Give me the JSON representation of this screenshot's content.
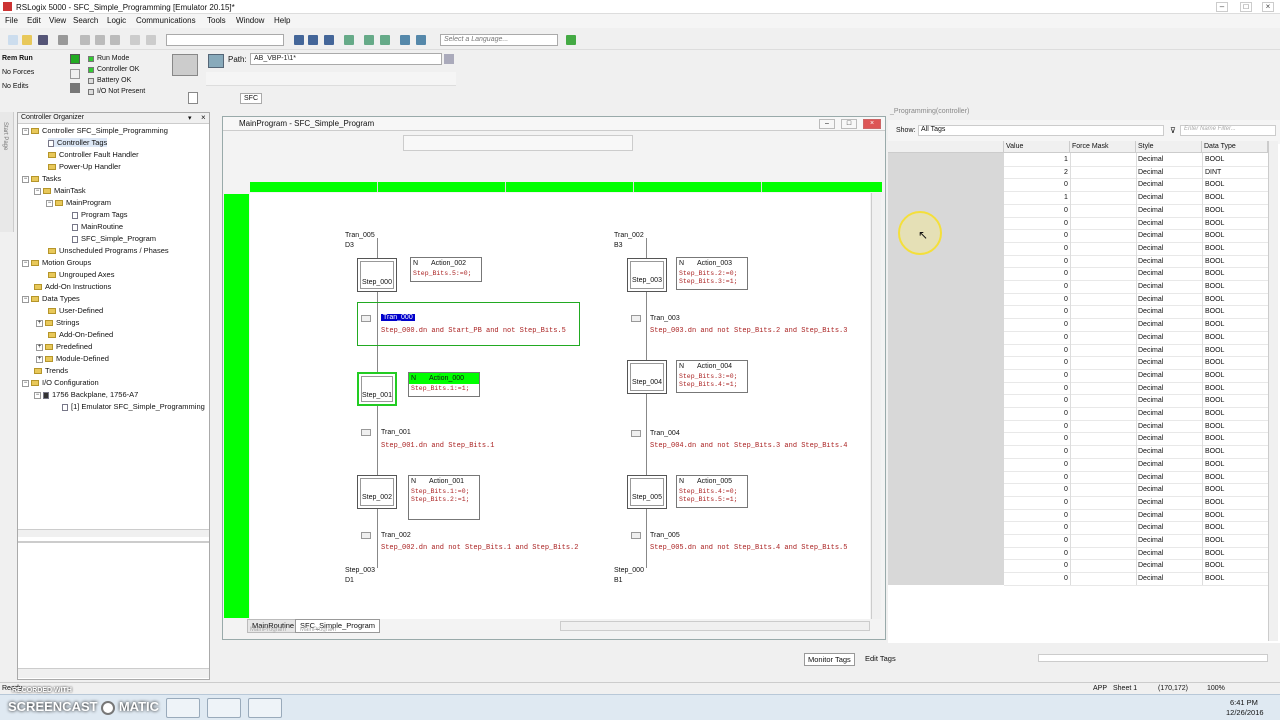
{
  "app": {
    "title": "RSLogix 5000 - SFC_Simple_Programming [Emulator 20.15]*",
    "menu": [
      "File",
      "Edit",
      "View",
      "Search",
      "Logic",
      "Communications",
      "Tools",
      "Window",
      "Help"
    ],
    "language_placeholder": "Select a Language..."
  },
  "status": {
    "mode": "Rem Run",
    "forces": "No Forces",
    "edits": "No Edits",
    "run_mode": "Run Mode",
    "controller_ok": "Controller OK",
    "battery_ok": "Battery OK",
    "io_not_present": "I/O Not Present"
  },
  "path": {
    "label": "Path:",
    "value": "AB_VBP-1\\1*",
    "sfc_tab": "SFC"
  },
  "organizer": {
    "title": "Controller Organizer",
    "items": [
      "Controller SFC_Simple_Programming",
      "Controller Tags",
      "Controller Fault Handler",
      "Power-Up Handler",
      "Tasks",
      "MainTask",
      "MainProgram",
      "Program Tags",
      "MainRoutine",
      "SFC_Simple_Program",
      "Unscheduled Programs / Phases",
      "Motion Groups",
      "Ungrouped Axes",
      "Add-On Instructions",
      "Data Types",
      "User-Defined",
      "Strings",
      "Add-On-Defined",
      "Predefined",
      "Module-Defined",
      "Trends",
      "I/O Configuration",
      "1756 Backplane, 1756-A7",
      "[1] Emulator SFC_Simple_Programming"
    ],
    "side_label": "Start Page"
  },
  "sfc": {
    "window_title": "MainProgram - SFC_Simple_Program",
    "tabs": [
      "MainRoutine",
      "SFC_Simple_Program"
    ],
    "tab_sub": [
      "MainProgram",
      "MainProgram"
    ],
    "left": {
      "top_tran": "Tran_005",
      "top_ref": "D3",
      "steps": [
        "Step_000",
        "Step_001",
        "Step_002"
      ],
      "actions": [
        {
          "q": "N",
          "name": "Action_002",
          "code": "Step_Bits.5:=0;"
        },
        {
          "q": "N",
          "name": "Action_000",
          "code": "Step_Bits.1:=1;"
        },
        {
          "q": "N",
          "name": "Action_001",
          "code": "Step_Bits.1:=0;\nStep_Bits.2:=1;"
        }
      ],
      "transitions": [
        {
          "name": "Tran_000",
          "cond": "Step_000.dn and Start_PB and not Step_Bits.5"
        },
        {
          "name": "Tran_001",
          "cond": "Step_001.dn and Step_Bits.1"
        },
        {
          "name": "Tran_002",
          "cond": "Step_002.dn and not Step_Bits.1 and Step_Bits.2"
        }
      ],
      "bottom_step": "Step_003",
      "bottom_ref": "D1"
    },
    "right": {
      "top_tran": "Tran_002",
      "top_ref": "B3",
      "steps": [
        "Step_003",
        "Step_004",
        "Step_005"
      ],
      "actions": [
        {
          "q": "N",
          "name": "Action_003",
          "code": "Step_Bits.2:=0;\nStep_Bits.3:=1;"
        },
        {
          "q": "N",
          "name": "Action_004",
          "code": "Step_Bits.3:=0;\nStep_Bits.4:=1;"
        },
        {
          "q": "N",
          "name": "Action_005",
          "code": "Step_Bits.4:=0;\nStep_Bits.5:=1;"
        }
      ],
      "transitions": [
        {
          "name": "Tran_003",
          "cond": "Step_003.dn and not Step_Bits.2 and Step_Bits.3"
        },
        {
          "name": "Tran_004",
          "cond": "Step_004.dn and not Step_Bits.3 and Step_Bits.4"
        },
        {
          "name": "Tran_005",
          "cond": "Step_005.dn and not Step_Bits.4 and Step_Bits.5"
        }
      ],
      "bottom_step": "Step_000",
      "bottom_ref": "B1"
    }
  },
  "tags": {
    "scope_title": "_Programming(controller)",
    "show_label": "Show:",
    "show_value": "All Tags",
    "filter_placeholder": "Enter Name Filter...",
    "columns": [
      "Value",
      "Force Mask",
      "Style",
      "Data Type"
    ],
    "rows": [
      {
        "value": "1",
        "style": "Decimal",
        "type": "BOOL"
      },
      {
        "value": "2",
        "style": "Decimal",
        "type": "DINT"
      },
      {
        "value": "0",
        "style": "Decimal",
        "type": "BOOL"
      },
      {
        "value": "1",
        "style": "Decimal",
        "type": "BOOL"
      },
      {
        "value": "0",
        "style": "Decimal",
        "type": "BOOL"
      },
      {
        "value": "0",
        "style": "Decimal",
        "type": "BOOL"
      },
      {
        "value": "0",
        "style": "Decimal",
        "type": "BOOL"
      },
      {
        "value": "0",
        "style": "Decimal",
        "type": "BOOL"
      },
      {
        "value": "0",
        "style": "Decimal",
        "type": "BOOL"
      },
      {
        "value": "0",
        "style": "Decimal",
        "type": "BOOL"
      },
      {
        "value": "0",
        "style": "Decimal",
        "type": "BOOL"
      },
      {
        "value": "0",
        "style": "Decimal",
        "type": "BOOL"
      },
      {
        "value": "0",
        "style": "Decimal",
        "type": "BOOL"
      },
      {
        "value": "0",
        "style": "Decimal",
        "type": "BOOL"
      },
      {
        "value": "0",
        "style": "Decimal",
        "type": "BOOL"
      },
      {
        "value": "0",
        "style": "Decimal",
        "type": "BOOL"
      },
      {
        "value": "0",
        "style": "Decimal",
        "type": "BOOL"
      },
      {
        "value": "0",
        "style": "Decimal",
        "type": "BOOL"
      },
      {
        "value": "0",
        "style": "Decimal",
        "type": "BOOL"
      },
      {
        "value": "0",
        "style": "Decimal",
        "type": "BOOL"
      },
      {
        "value": "0",
        "style": "Decimal",
        "type": "BOOL"
      },
      {
        "value": "0",
        "style": "Decimal",
        "type": "BOOL"
      },
      {
        "value": "0",
        "style": "Decimal",
        "type": "BOOL"
      },
      {
        "value": "0",
        "style": "Decimal",
        "type": "BOOL"
      },
      {
        "value": "0",
        "style": "Decimal",
        "type": "BOOL"
      },
      {
        "value": "0",
        "style": "Decimal",
        "type": "BOOL"
      },
      {
        "value": "0",
        "style": "Decimal",
        "type": "BOOL"
      },
      {
        "value": "0",
        "style": "Decimal",
        "type": "BOOL"
      },
      {
        "value": "0",
        "style": "Decimal",
        "type": "BOOL"
      },
      {
        "value": "0",
        "style": "Decimal",
        "type": "BOOL"
      },
      {
        "value": "0",
        "style": "Decimal",
        "type": "BOOL"
      },
      {
        "value": "0",
        "style": "Decimal",
        "type": "BOOL"
      },
      {
        "value": "0",
        "style": "Decimal",
        "type": "BOOL"
      },
      {
        "value": "0",
        "style": "Decimal",
        "type": "BOOL"
      }
    ],
    "bottom_tabs": [
      "Monitor Tags",
      "Edit Tags"
    ]
  },
  "statusbar": {
    "left": "Ready",
    "app": "APP",
    "sheet": "Sheet 1",
    "coords": "(170,172)",
    "zoom": "100%"
  },
  "taskbar": {
    "watermark_top": "RECORDED WITH",
    "watermark": "SCREENCAST",
    "watermark_suffix": "MATIC",
    "time": "6:41 PM",
    "date": "12/26/2016"
  },
  "colors": {
    "sfc_green": "#00ff00",
    "code_red": "#a22222",
    "selection_blue": "#0000cc"
  }
}
